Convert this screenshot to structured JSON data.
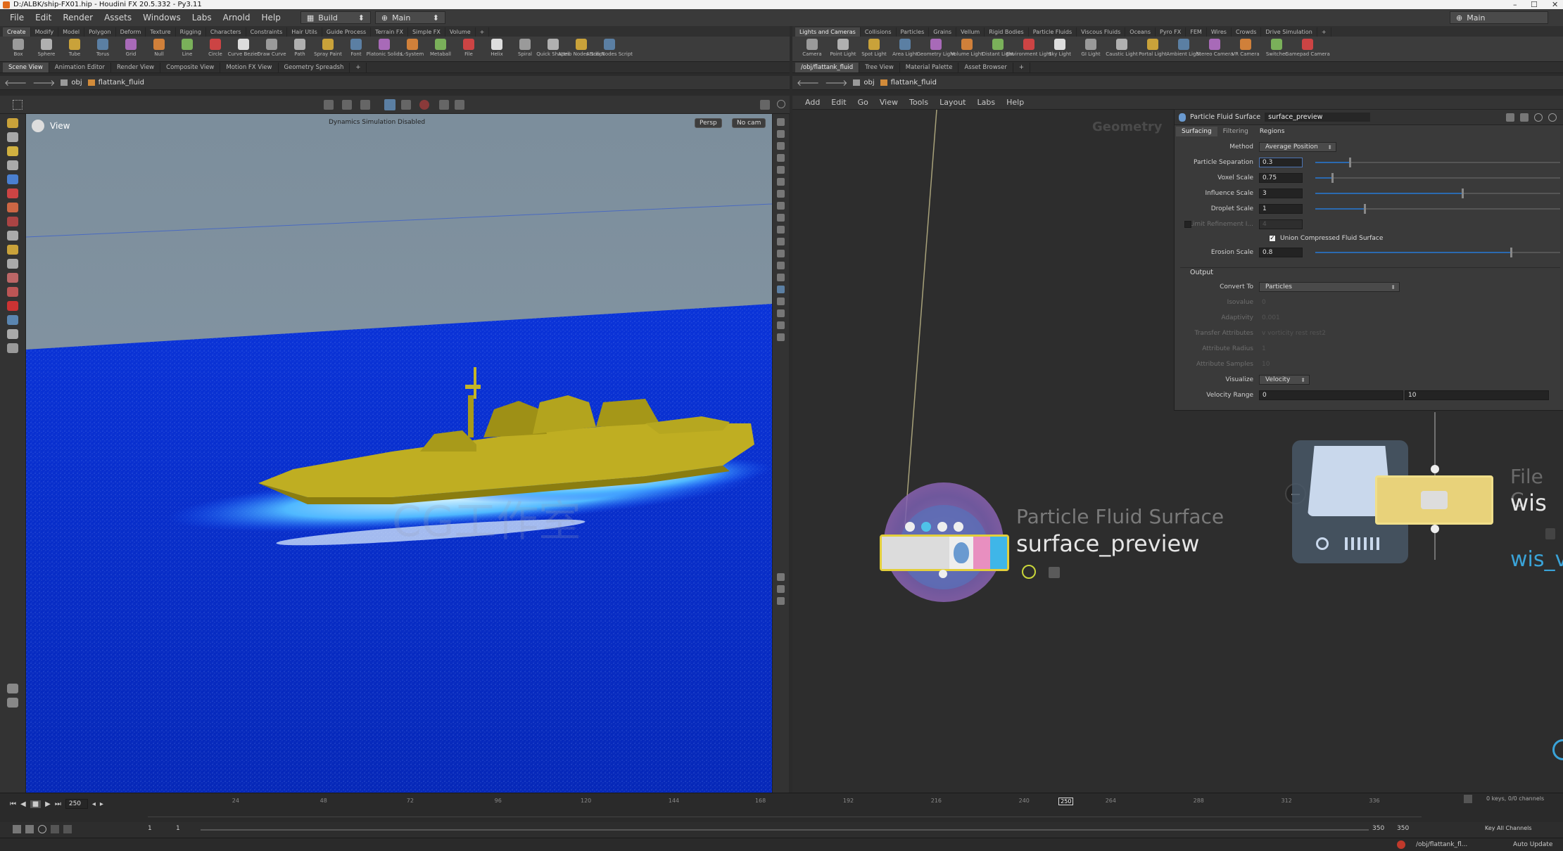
{
  "window": {
    "title": "D:/ALBK/ship-FX01.hip - Houdini FX 20.5.332 - Py3.11"
  },
  "menu": [
    "File",
    "Edit",
    "Render",
    "Assets",
    "Windows",
    "Labs",
    "Arnold",
    "Help"
  ],
  "desktop": {
    "build_label": "Build",
    "main_label": "Main",
    "right_label": "Main"
  },
  "shelf_left": {
    "tabs": [
      "Create",
      "Modify",
      "Model",
      "Polygon",
      "Deform",
      "Texture",
      "Rigging",
      "Characters",
      "Constraints",
      "Hair Utils",
      "Guide Process",
      "Terrain FX",
      "Simple FX",
      "Volume"
    ],
    "tools": [
      "Box",
      "Sphere",
      "Tube",
      "Torus",
      "Grid",
      "Null",
      "Line",
      "Circle",
      "Curve Bezier",
      "Draw Curve",
      "Path",
      "Spray Paint",
      "Font",
      "Platonic Solids",
      "L-System",
      "Metaball",
      "File",
      "Helix",
      "Spiral",
      "Quick Shapes",
      "Attrib Nodes Script",
      "Attrib Nodes Script"
    ]
  },
  "shelf_right": {
    "tabs": [
      "Lights and Cameras",
      "Collisions",
      "Particles",
      "Grains",
      "Vellum",
      "Rigid Bodies",
      "Particle Fluids",
      "Viscous Fluids",
      "Oceans",
      "Pyro FX",
      "FEM",
      "Wires",
      "Crowds",
      "Drive Simulation"
    ],
    "tools": [
      "Camera",
      "Point Light",
      "Spot Light",
      "Area Light",
      "Geometry Light",
      "Volume Light",
      "Distant Light",
      "Environment Light",
      "Sky Light",
      "GI Light",
      "Caustic Light",
      "Portal Light",
      "Ambient Light",
      "Stereo Camera",
      "VR Camera",
      "Switcher",
      "Gamepad Camera"
    ]
  },
  "left_pane": {
    "tabs": [
      "Scene View",
      "Animation Editor",
      "Render View",
      "Composite View",
      "Motion FX View",
      "Geometry Spreadsh"
    ],
    "path": [
      "obj",
      "flattank_fluid"
    ]
  },
  "viewport": {
    "label": "View",
    "notice": "Dynamics Simulation Disabled",
    "persp": "Persp",
    "cam": "No cam",
    "watermark": "CG工作室"
  },
  "right_pane": {
    "tabs": [
      "/obj/flattank_fluid",
      "Tree View",
      "Material Palette",
      "Asset Browser"
    ],
    "path": [
      "obj",
      "flattank_fluid"
    ],
    "menu": [
      "Add",
      "Edit",
      "Go",
      "View",
      "Tools",
      "Layout",
      "Labs",
      "Help"
    ],
    "context": "Geometry"
  },
  "params": {
    "node_type": "Particle Fluid Surface",
    "node_name": "surface_preview",
    "tabs": [
      "Surfacing",
      "Filtering",
      "Regions"
    ],
    "method_label": "Method",
    "method_value": "Average Position",
    "particle_sep_label": "Particle Separation",
    "particle_sep_value": "0.3",
    "voxel_label": "Voxel Scale",
    "voxel_value": "0.75",
    "influence_label": "Influence Scale",
    "influence_value": "3",
    "droplet_label": "Droplet Scale",
    "droplet_value": "1",
    "limit_label": "Limit Refinement I...",
    "limit_value": "4",
    "union_label": "Union Compressed Fluid Surface",
    "erosion_label": "Erosion Scale",
    "erosion_value": "0.8",
    "output_header": "Output",
    "convert_label": "Convert To",
    "convert_value": "Particles",
    "isovalue_label": "Isovalue",
    "isovalue_value": "0",
    "adaptivity_label": "Adaptivity",
    "adaptivity_value": "0.001",
    "transfer_label": "Transfer Attributes",
    "transfer_value": "v vorticity rest rest2",
    "radius_label": "Attribute Radius",
    "radius_value": "1",
    "samples_label": "Attribute Samples",
    "samples_value": "10",
    "visualize_label": "Visualize",
    "visualize_value": "Velocity",
    "vrange_label": "Velocity Range",
    "vrange_min": "0",
    "vrange_max": "10",
    "levels": {
      "particle_sep": 0.14,
      "voxel": 0.07,
      "influence": 0.6,
      "droplet": 0.2,
      "erosion": 0.8
    }
  },
  "nodes": {
    "surface": {
      "type": "Particle Fluid Surface",
      "name": "surface_preview"
    },
    "file": {
      "type": "File C",
      "name": "wis",
      "name2": "wis_v"
    }
  },
  "timeline": {
    "frame": "250",
    "ticks": [
      "24",
      "48",
      "72",
      "96",
      "120",
      "144",
      "168",
      "192",
      "216",
      "240",
      "264",
      "288",
      "312",
      "336"
    ],
    "current": "250",
    "start1": "1",
    "start2": "1",
    "end1": "350",
    "end2": "350",
    "keys_info": "0 keys, 0/0 channels",
    "key_all": "Key All Channels"
  },
  "status": {
    "path": "/obj/flattank_fl...",
    "auto": "Auto Update"
  }
}
